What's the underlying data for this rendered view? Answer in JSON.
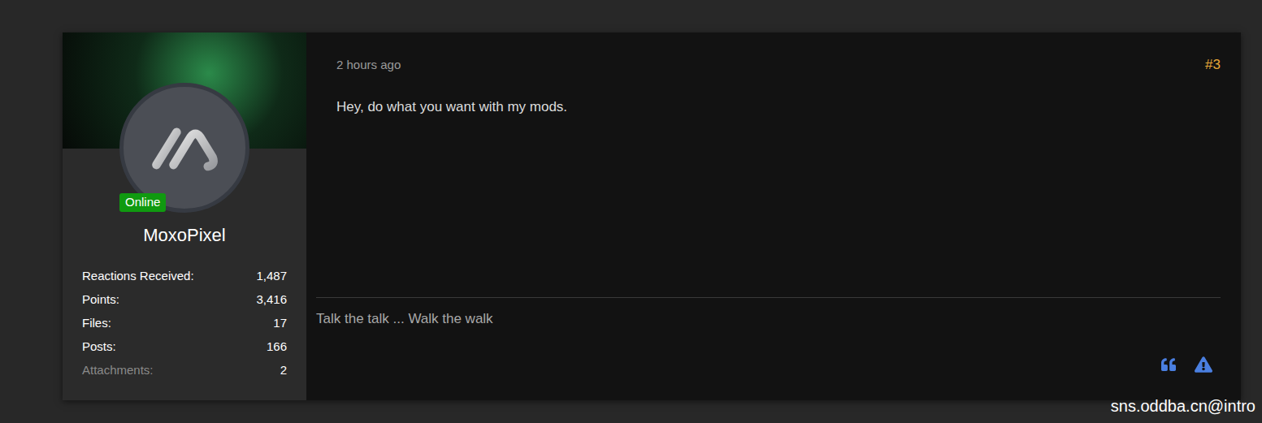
{
  "post": {
    "time": "2 hours ago",
    "number": "#3",
    "message": "Hey, do what you want with my mods.",
    "signature": "Talk the talk ... Walk the walk"
  },
  "user": {
    "name": "MoxoPixel",
    "status": "Online",
    "online": true,
    "stats": [
      {
        "label": "Reactions Received:",
        "value": "1,487",
        "muted": false
      },
      {
        "label": "Points:",
        "value": "3,416",
        "muted": false
      },
      {
        "label": "Files:",
        "value": "17",
        "muted": false
      },
      {
        "label": "Posts:",
        "value": "166",
        "muted": false
      },
      {
        "label": "Attachments:",
        "value": "2",
        "muted": true
      }
    ]
  },
  "watermark": "sns.oddba.cn@intro"
}
